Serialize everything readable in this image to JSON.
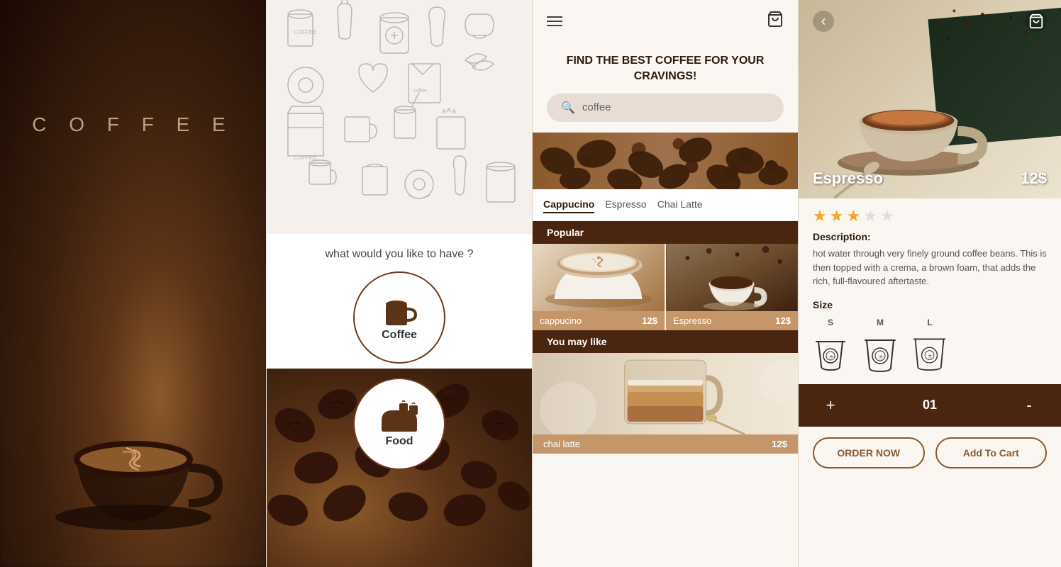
{
  "panel1": {
    "title": "C O F F E E"
  },
  "panel2": {
    "doodle_header_alt": "coffee doodles illustration",
    "question": "what would you like to have ?",
    "categories": [
      {
        "id": "coffee",
        "label": "Coffee",
        "icon": "☕"
      },
      {
        "id": "food",
        "label": "Food",
        "icon": "🍞"
      }
    ]
  },
  "panel3": {
    "hero_text": "FIND THE BEST COFFEE FOR\nYOUR CRAVINGS!",
    "search_placeholder": "coffee",
    "search_value": "coffee",
    "filter_tabs": [
      {
        "label": "Cappucino",
        "active": true
      },
      {
        "label": "Espresso",
        "active": false
      },
      {
        "label": "Chai Latte",
        "active": false
      }
    ],
    "popular_label": "Popular",
    "you_may_like_label": "You may like",
    "products": [
      {
        "name": "cappucino",
        "price": "12$"
      },
      {
        "name": "Espresso",
        "price": "12$"
      }
    ],
    "you_may_like": [
      {
        "name": "chai latte",
        "price": "12$"
      }
    ]
  },
  "panel4": {
    "product_name": "Espresso",
    "product_price": "12$",
    "stars": 3,
    "total_stars": 5,
    "description_title": "Description:",
    "description": "hot water through very finely ground coffee beans. This is then topped with a crema, a brown foam, that adds the rich, full-flavoured aftertaste.",
    "size_label": "Size",
    "sizes": [
      {
        "label": "S",
        "id": "small"
      },
      {
        "label": "M",
        "id": "medium"
      },
      {
        "label": "L",
        "id": "large"
      }
    ],
    "quantity": "01",
    "plus_label": "+",
    "minus_label": "-",
    "order_now_label": "ORDER NOW",
    "add_to_cart_label": "Add To Cart"
  }
}
